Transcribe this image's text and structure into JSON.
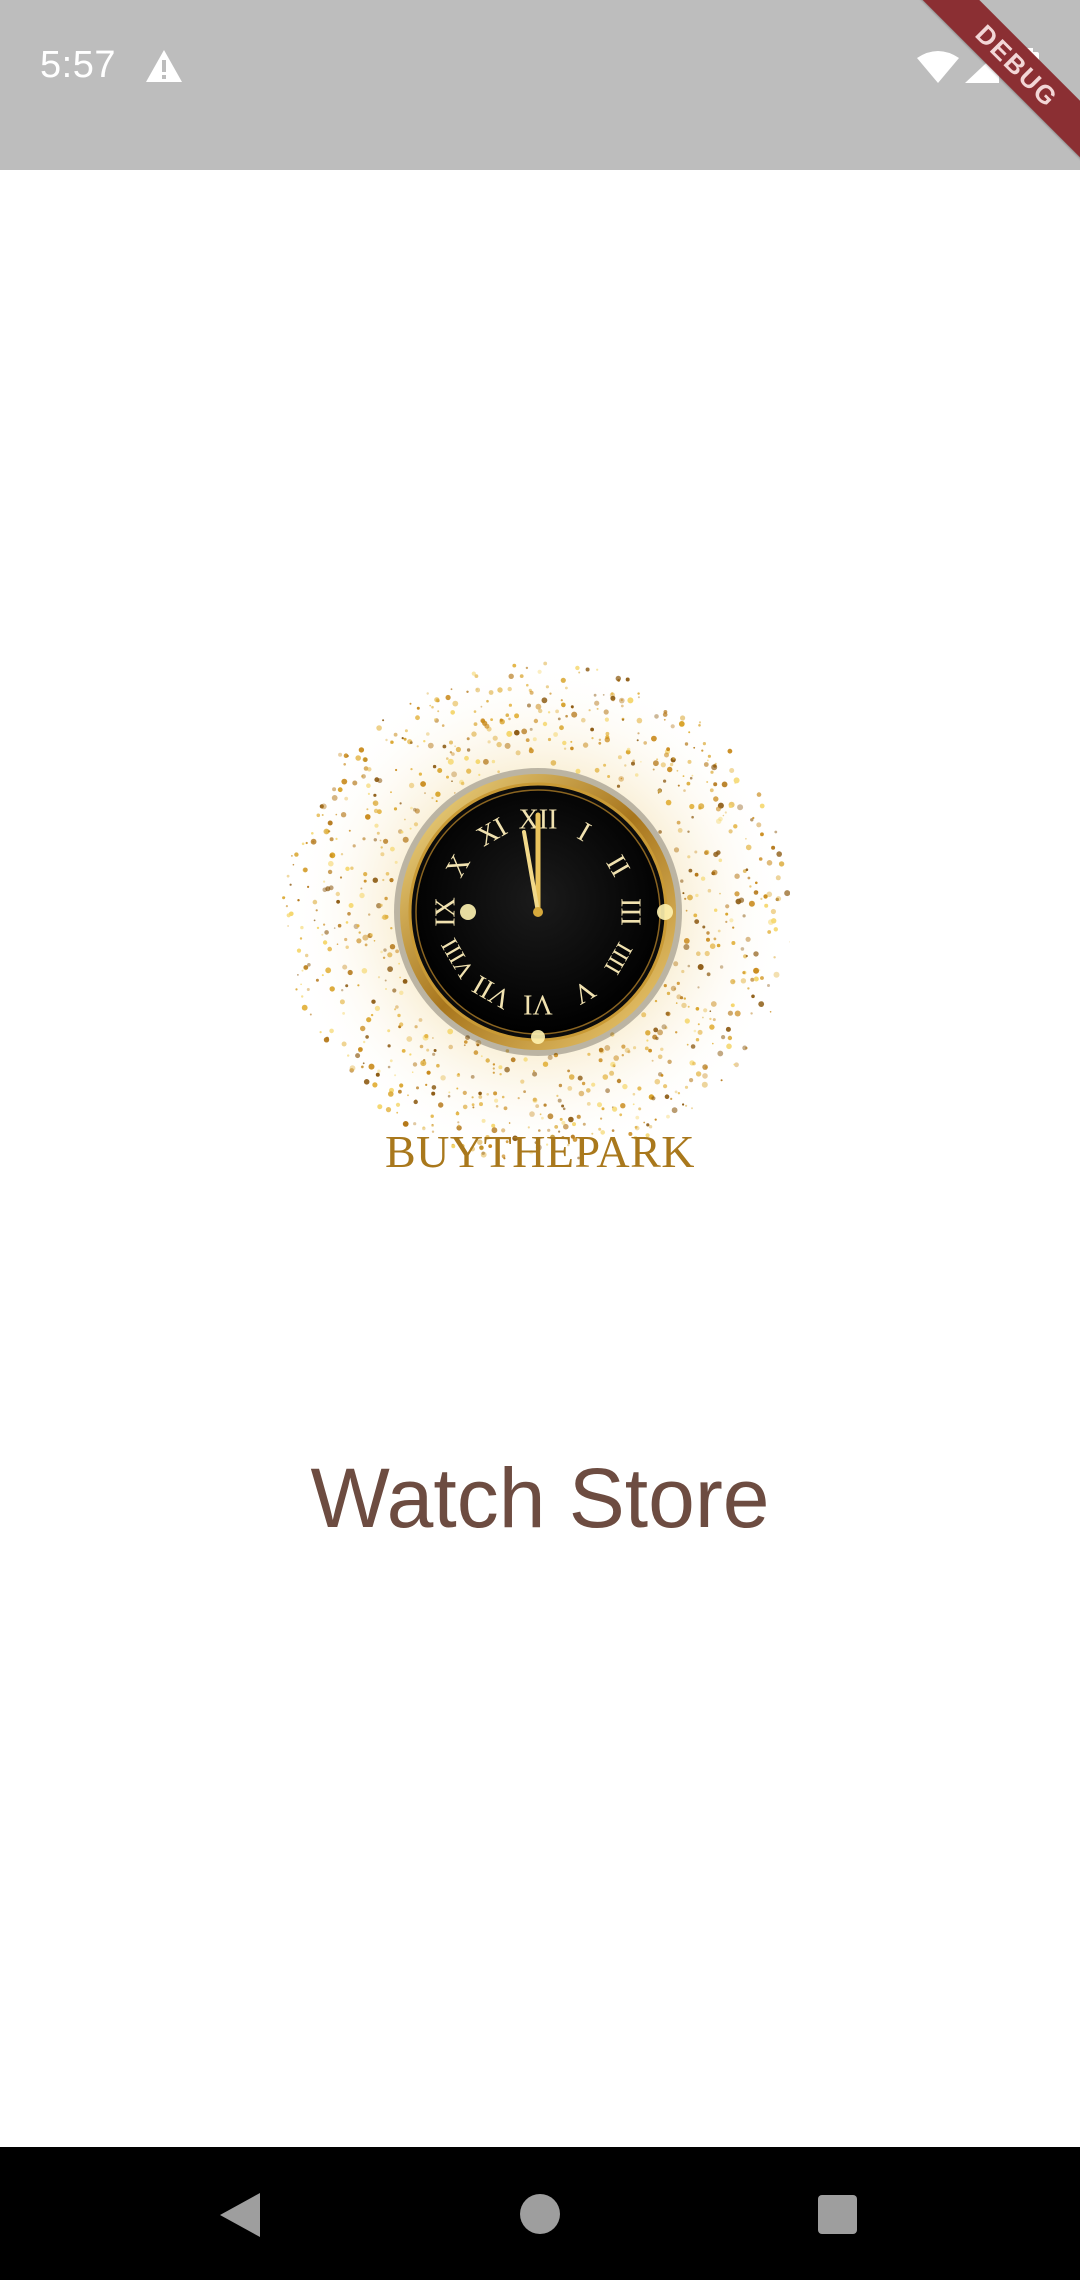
{
  "status_bar": {
    "time": "5:57",
    "debug_label": "DEBUG",
    "icons": [
      "warning-icon",
      "wifi-icon",
      "signal-icon",
      "battery-icon"
    ]
  },
  "logo": {
    "brand": "BUYTHEPARK",
    "numerals": [
      "XII",
      "I",
      "II",
      "III",
      "IIII",
      "V",
      "VI",
      "VII",
      "VIII",
      "IX",
      "X",
      "XI"
    ]
  },
  "main": {
    "title": "Watch Store"
  },
  "nav_bar": {
    "icons": [
      "back-icon",
      "home-icon",
      "recents-icon"
    ]
  },
  "colors": {
    "status_bar": "#bdbdbd",
    "title": "#6d4c41",
    "gold": "#a9781c",
    "debug_ribbon": "#8b2f33"
  }
}
